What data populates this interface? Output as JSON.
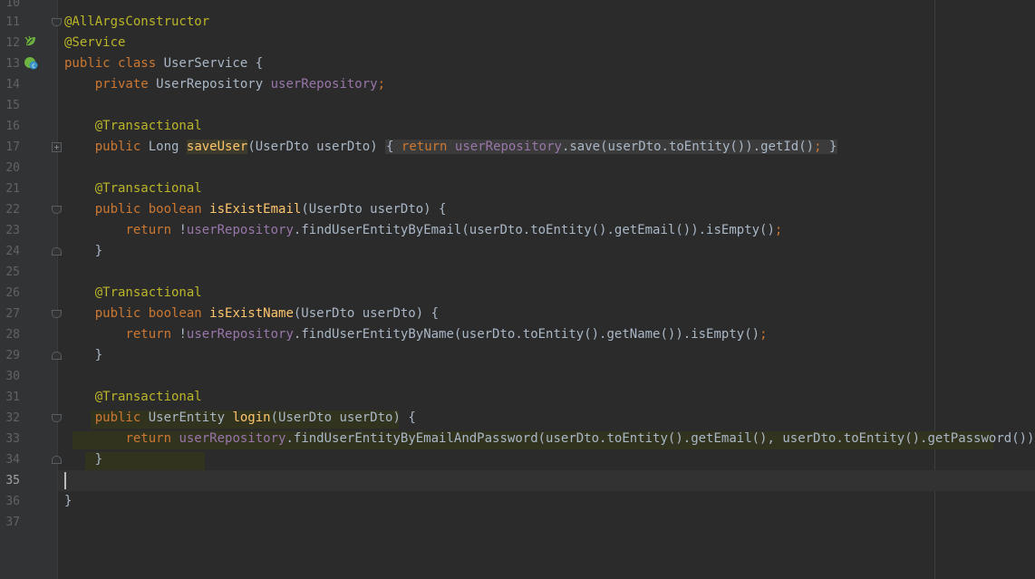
{
  "colors": {
    "background": "#2b2b2b",
    "gutter": "#313335",
    "keyword": "#cc7832",
    "annotation": "#bbb529",
    "field": "#9876aa",
    "method": "#ffc66d",
    "plain": "#a9b7c6"
  },
  "gutter_icons": [
    "spring-bean-icon",
    "spring-class-icon"
  ],
  "lines": [
    {
      "num": "10",
      "text": ""
    },
    {
      "num": "11",
      "text": "@AllArgsConstructor"
    },
    {
      "num": "12",
      "text": "@Service"
    },
    {
      "num": "13",
      "text": "public class UserService {"
    },
    {
      "num": "14",
      "text": "    private UserRepository userRepository;"
    },
    {
      "num": "15",
      "text": ""
    },
    {
      "num": "16",
      "text": "    @Transactional"
    },
    {
      "num": "17",
      "text": "    public Long saveUser(UserDto userDto) { return userRepository.save(userDto.toEntity()).getId(); }"
    },
    {
      "num": "20",
      "text": ""
    },
    {
      "num": "21",
      "text": "    @Transactional"
    },
    {
      "num": "22",
      "text": "    public boolean isExistEmail(UserDto userDto) {"
    },
    {
      "num": "23",
      "text": "        return !userRepository.findUserEntityByEmail(userDto.toEntity().getEmail()).isEmpty();"
    },
    {
      "num": "24",
      "text": "    }"
    },
    {
      "num": "25",
      "text": ""
    },
    {
      "num": "26",
      "text": "    @Transactional"
    },
    {
      "num": "27",
      "text": "    public boolean isExistName(UserDto userDto) {"
    },
    {
      "num": "28",
      "text": "        return !userRepository.findUserEntityByName(userDto.toEntity().getName()).isEmpty();"
    },
    {
      "num": "29",
      "text": "    }"
    },
    {
      "num": "30",
      "text": ""
    },
    {
      "num": "31",
      "text": "    @Transactional"
    },
    {
      "num": "32",
      "text": "    public UserEntity login(UserDto userDto) {"
    },
    {
      "num": "33",
      "text": "        return userRepository.findUserEntityByEmailAndPassword(userDto.toEntity().getEmail(), userDto.toEntity().getPassword());"
    },
    {
      "num": "34",
      "text": "    }"
    },
    {
      "num": "35",
      "text": ""
    },
    {
      "num": "36",
      "text": "}"
    },
    {
      "num": "37",
      "text": ""
    }
  ],
  "tokens": {
    "l11": "@AllArgsConstructor",
    "l12": "@Service",
    "l13a": "public class ",
    "l13b": "UserService {",
    "l14a": "private ",
    "l14b": "UserRepository ",
    "l14c": "userRepository",
    "l14d": ";",
    "ann": "@Transactional",
    "l17a": "public ",
    "l17b": "Long ",
    "l17c": "saveUser",
    "l17d": "(UserDto userDto) ",
    "l17e": "{ ",
    "l17f": "return ",
    "l17g": "userRepository",
    "l17h": ".save(userDto.toEntity()).getId()",
    "l17i": "; ",
    "l17j": "}",
    "l22a": "public boolean ",
    "l22b": "isExistEmail",
    "l22c": "(UserDto userDto) {",
    "ret": "return ",
    "bang": "!",
    "repo": "userRepository",
    "l23c": ".findUserEntityByEmail(userDto.toEntity().getEmail()).isEmpty()",
    "semi": ";",
    "brace_close": "}",
    "l27b": "isExistName",
    "l27c": "(UserDto userDto) {",
    "l28c": ".findUserEntityByName(userDto.toEntity().getName()).isEmpty()",
    "l32a": "public ",
    "l32b": "UserEntity ",
    "l32c": "login",
    "l32d": "(UserDto userDto) {",
    "l33c": ".findUserEntityByEmailAndPassword(userDto.toEntity().getEmail(), userDto.toEntity().getPassword())"
  }
}
